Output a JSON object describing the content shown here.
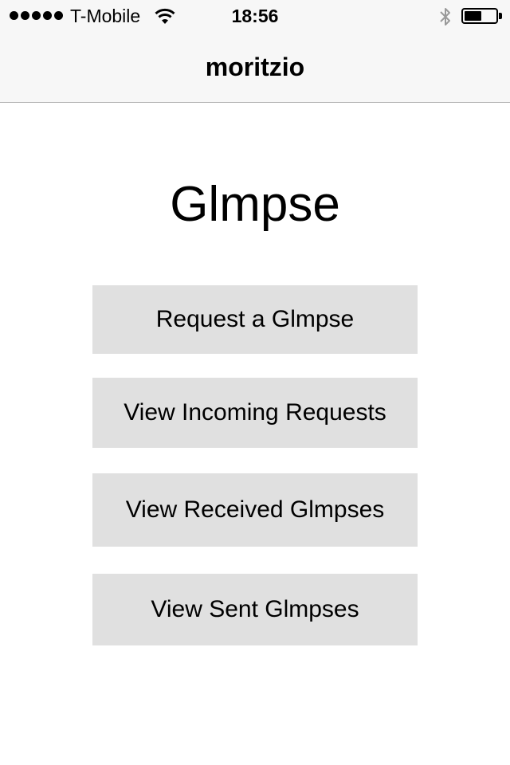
{
  "status_bar": {
    "carrier": "T-Mobile",
    "time": "18:56",
    "signal_bars": 5,
    "battery_level": 0.55,
    "icons": [
      "wifi-icon",
      "bluetooth-icon",
      "battery-icon"
    ]
  },
  "nav": {
    "title": "moritzio"
  },
  "main": {
    "title": "Glmpse",
    "buttons": [
      {
        "label": "Request a Glmpse"
      },
      {
        "label": "View Incoming Requests"
      },
      {
        "label": "View Received Glmpses"
      },
      {
        "label": "View Sent Glmpses"
      }
    ]
  },
  "colors": {
    "nav_background": "#f7f7f7",
    "button_background": "#e0e0e0",
    "text": "#000000"
  }
}
